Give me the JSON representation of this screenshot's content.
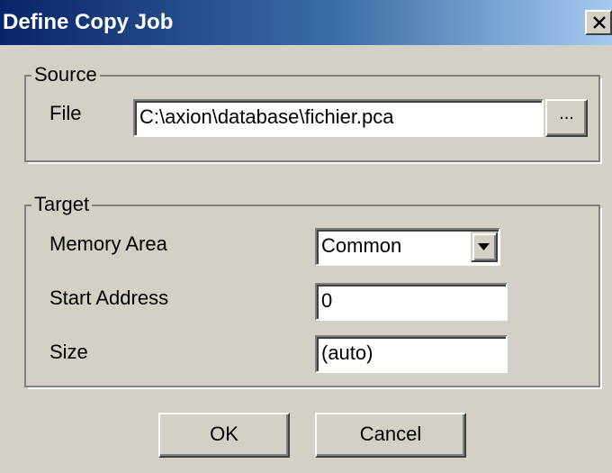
{
  "window": {
    "title": "Define Copy Job",
    "close_icon": "close-icon"
  },
  "source": {
    "legend": "Source",
    "file_label": "File",
    "file_value": "C:\\axion\\database\\fichier.pca",
    "browse_label": "..."
  },
  "target": {
    "legend": "Target",
    "memory_area_label": "Memory Area",
    "memory_area_value": "Common",
    "start_address_label": "Start Address",
    "start_address_value": "0",
    "size_label": "Size",
    "size_value": "(auto)"
  },
  "buttons": {
    "ok_label": "OK",
    "cancel_label": "Cancel"
  },
  "colors": {
    "titlebar_start": "#0a246a",
    "titlebar_end": "#a6caf0",
    "dialog_bg": "#d4d0c8"
  }
}
